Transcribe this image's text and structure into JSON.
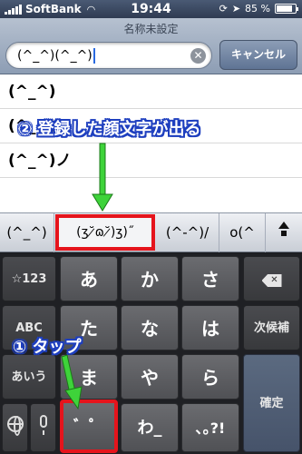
{
  "status_bar": {
    "carrier": "SoftBank",
    "time": "19:44",
    "battery_percent_label": "85 %",
    "battery_level": 0.85
  },
  "navbar": {
    "title": "名称未設定",
    "search_value": "(^_^)(^_^)",
    "cancel_label": "キャンセル"
  },
  "results": [
    "(^_^)",
    "(^_^)",
    "(^_^)ノ"
  ],
  "candidates": {
    "items": [
      "(^_^)",
      "(ʒ˘̷ɷ˘̷)ʒ)˝",
      "(^-^)/",
      "o(^"
    ],
    "selected_index": 1
  },
  "keyboard": {
    "num_key": "☆123",
    "abc_key": "ABC",
    "aiu_key": "あいう",
    "next_candidate": "次候補",
    "confirm": "確定",
    "row1": [
      "あ",
      "か",
      "さ"
    ],
    "row2": [
      "た",
      "な",
      "は"
    ],
    "row3": [
      "ま",
      "や",
      "ら"
    ],
    "row4": [
      "゛゜",
      "わ_",
      "､｡?!"
    ]
  },
  "annotations": {
    "step2": "② 登録した顔文字が出る",
    "step1": "① タップ"
  },
  "colors": {
    "highlight": "#e5141c",
    "annotation_arrow": "#3ed33a",
    "annotation_outline": "#1e3fbf"
  }
}
